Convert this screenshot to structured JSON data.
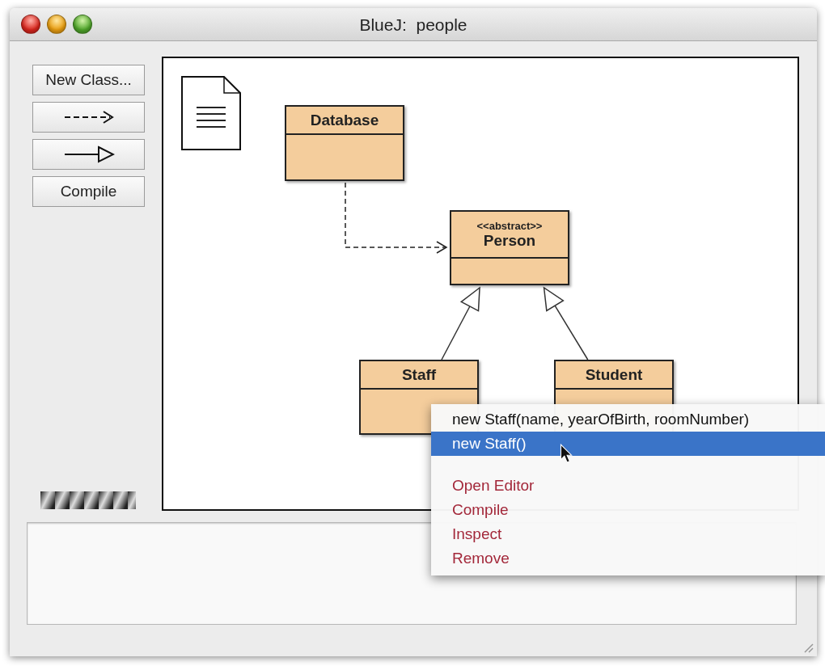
{
  "window": {
    "title": "BlueJ:  people"
  },
  "toolbar": {
    "buttons": [
      {
        "kind": "text",
        "label": "New Class..."
      },
      {
        "kind": "uses-arrow"
      },
      {
        "kind": "inherits-arrow"
      },
      {
        "kind": "text",
        "label": "Compile"
      }
    ]
  },
  "diagram": {
    "classes": [
      {
        "name": "Database"
      },
      {
        "stereotype": "<<abstract>>",
        "name": "Person"
      },
      {
        "name": "Staff"
      },
      {
        "name": "Student"
      }
    ],
    "relations": [
      {
        "kind": "uses"
      },
      {
        "kind": "inherits"
      },
      {
        "kind": "inherits"
      }
    ]
  },
  "context_menu": {
    "items": [
      {
        "kind": "constructor",
        "label": "new Staff(name, yearOfBirth, roomNumber)",
        "selected": false
      },
      {
        "kind": "constructor",
        "label": "new Staff()",
        "selected": true
      },
      {
        "kind": "command",
        "label": "Open Editor",
        "selected": false
      },
      {
        "kind": "command",
        "label": "Compile",
        "selected": false
      },
      {
        "kind": "command",
        "label": "Inspect",
        "selected": false
      },
      {
        "kind": "command",
        "label": "Remove",
        "selected": false
      }
    ]
  }
}
